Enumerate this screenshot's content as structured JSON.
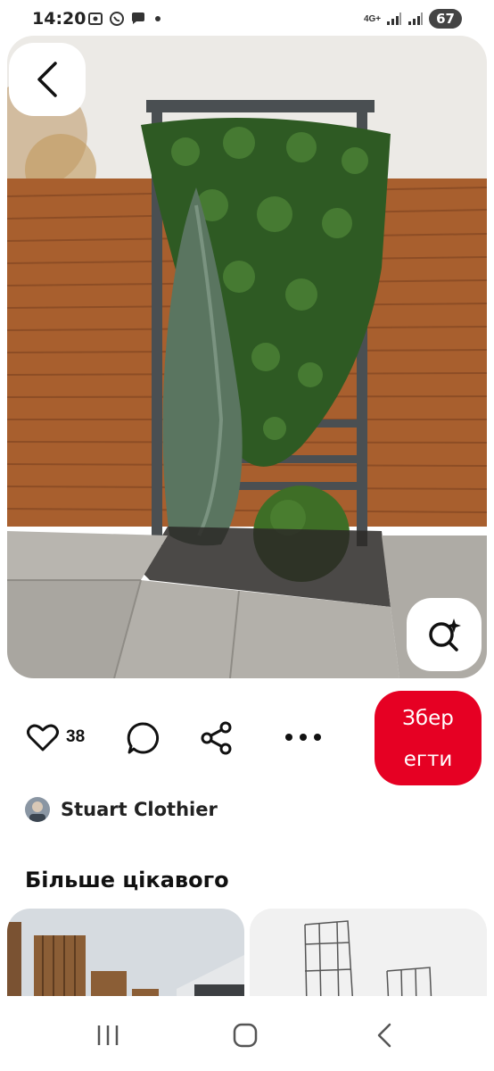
{
  "status_bar": {
    "time": "14:20",
    "left_icons": [
      "screenshot-icon",
      "viber-icon",
      "chat-bubble-icon",
      "dot-icon"
    ],
    "network_label": "4G+",
    "battery": "67"
  },
  "pin": {
    "image_icon": "garden-trellis-photo",
    "back_icon": "chevron-left-icon",
    "lens_icon": "visual-search-icon"
  },
  "actions": {
    "like_count": "38",
    "save_label_line1": "Збер",
    "save_label_line2": "егти",
    "icons": [
      "heart-icon",
      "comment-icon",
      "share-icon",
      "more-icon"
    ]
  },
  "author": {
    "name": "Stuart Clothier"
  },
  "more_section": {
    "title": "Більше цікавого"
  },
  "colors": {
    "save_button": "#e60023",
    "text": "#111111"
  },
  "nav_bar": {
    "icons": [
      "recent-apps-icon",
      "home-icon",
      "back-icon"
    ]
  }
}
